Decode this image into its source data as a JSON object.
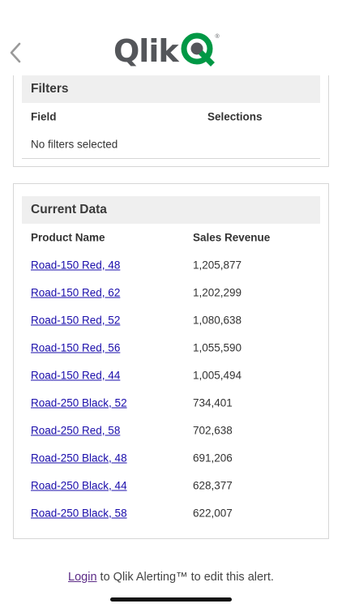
{
  "header": {
    "logo_text": "Qlik",
    "reg_mark": "®",
    "colors": {
      "logo_gray": "#54565a",
      "logo_green": "#009845"
    }
  },
  "filters": {
    "title": "Filters",
    "col_field": "Field",
    "col_selections": "Selections",
    "empty_text": "No filters selected"
  },
  "current_data": {
    "title": "Current Data",
    "col_product": "Product Name",
    "col_revenue": "Sales Revenue",
    "rows": [
      {
        "product": "Road-150 Red, 48",
        "revenue": "1,205,877"
      },
      {
        "product": "Road-150 Red, 62",
        "revenue": "1,202,299"
      },
      {
        "product": "Road-150 Red, 52",
        "revenue": "1,080,638"
      },
      {
        "product": "Road-150 Red, 56",
        "revenue": "1,055,590"
      },
      {
        "product": "Road-150 Red, 44",
        "revenue": "1,005,494"
      },
      {
        "product": "Road-250 Black, 52",
        "revenue": "734,401"
      },
      {
        "product": "Road-250 Red, 58",
        "revenue": "702,638"
      },
      {
        "product": "Road-250 Black, 48",
        "revenue": "691,206"
      },
      {
        "product": "Road-250 Black, 44",
        "revenue": "628,377"
      },
      {
        "product": "Road-250 Black, 58",
        "revenue": "622,007"
      }
    ]
  },
  "footer": {
    "login_label": "Login",
    "rest_text": " to Qlik Alerting™ to edit this alert."
  }
}
